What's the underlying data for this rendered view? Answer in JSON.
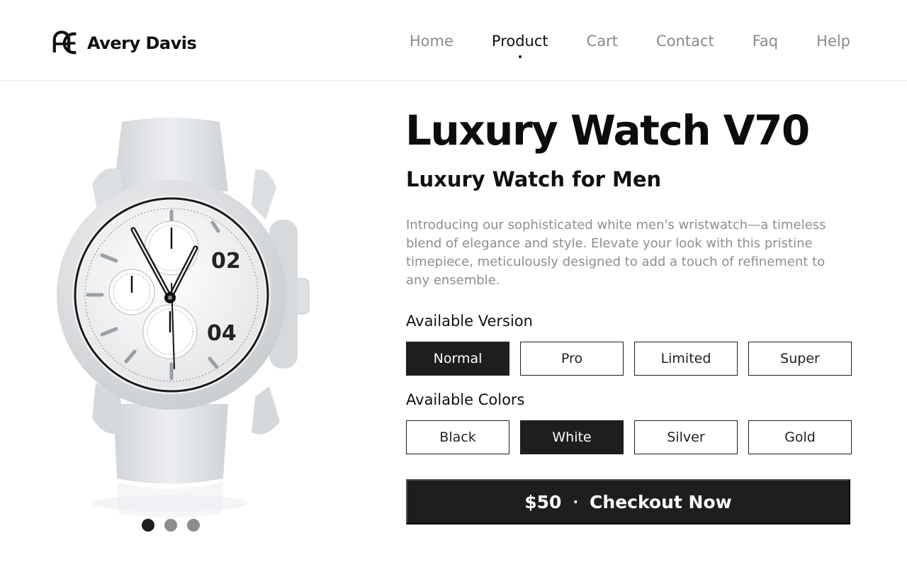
{
  "brand": {
    "name": "Avery Davis",
    "logo_icon": "ae-monogram-logo"
  },
  "nav": {
    "items": [
      {
        "label": "Home"
      },
      {
        "label": "Product"
      },
      {
        "label": "Cart"
      },
      {
        "label": "Contact"
      },
      {
        "label": "Faq"
      },
      {
        "label": "Help"
      }
    ],
    "active": "Product"
  },
  "gallery": {
    "image_icon": "white-chronograph-watch",
    "dial_numbers": [
      "02",
      "04"
    ],
    "slide_count": 3,
    "active_slide": 1
  },
  "product": {
    "title": "Luxury Watch V70",
    "subtitle": "Luxury Watch for Men",
    "description": "Introducing our sophisticated white men's wristwatch—a timeless blend of elegance and style. Elevate your look with this pristine timepiece, meticulously designed to add a touch of refinement to any ensemble."
  },
  "versions": {
    "label": "Available Version",
    "options": [
      "Normal",
      "Pro",
      "Limited",
      "Super"
    ],
    "selected": "Normal"
  },
  "colors": {
    "label": "Available Colors",
    "options": [
      "Black",
      "White",
      "Silver",
      "Gold"
    ],
    "selected": "White"
  },
  "checkout": {
    "price": "$50",
    "separator": "·",
    "label": "Checkout Now"
  },
  "theme": {
    "accent": "#1e1e1e",
    "muted_text": "#8e8e8e",
    "background": "#ffffff"
  }
}
